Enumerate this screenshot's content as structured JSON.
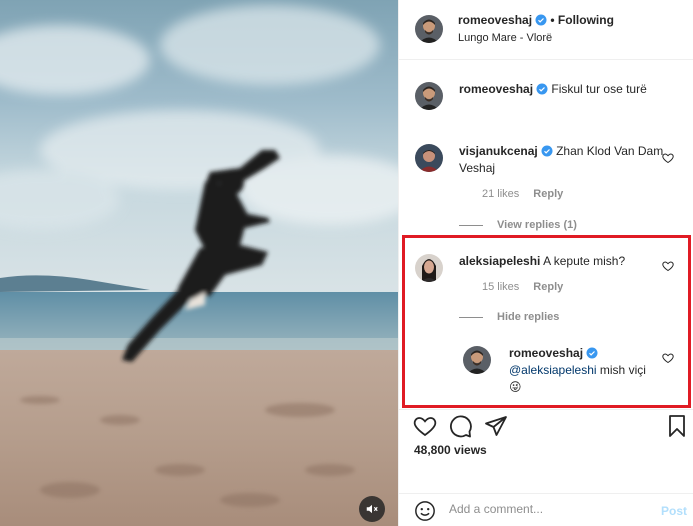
{
  "post": {
    "author": "romeoveshaj",
    "follow_state": "• Following",
    "location": "Lungo Mare - Vlorë",
    "caption_user": "romeoveshaj",
    "caption": "Fiskul tur ose turë",
    "views": "48,800 views"
  },
  "comments": [
    {
      "user": "visjanukcenaj",
      "verified": true,
      "text": "Zhan Klod Van Dam Veshaj",
      "likes": "21 likes",
      "reply_label": "Reply",
      "replies_toggle": "View replies (1)"
    },
    {
      "user": "aleksiapeleshi",
      "verified": false,
      "text": "A kepute mish?",
      "likes": "15 likes",
      "reply_label": "Reply",
      "replies_toggle": "Hide replies",
      "reply": {
        "user": "romeoveshaj",
        "verified": true,
        "mention": "@aleksiapeleshi",
        "text": " mish viçi 😜"
      }
    }
  ],
  "composer": {
    "placeholder": "Add a comment...",
    "post_label": "Post"
  },
  "colors": {
    "verified_blue": "#3897f0",
    "highlight_red": "#e01b24",
    "post_disabled": "#b2dffc"
  },
  "icons": {
    "like": "heart-icon",
    "comment": "comment-icon",
    "share": "paper-plane-icon",
    "save": "bookmark-icon",
    "emoji": "smiley-icon",
    "mute": "speaker-muted-icon"
  }
}
